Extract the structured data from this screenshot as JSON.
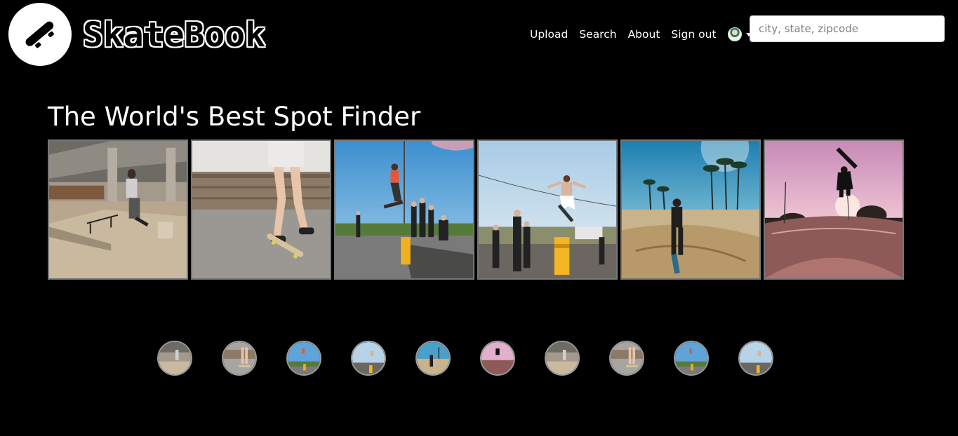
{
  "brand": {
    "name": "SkateBook",
    "logo_icon": "skateboard-icon"
  },
  "nav": {
    "upload_label": "Upload",
    "search_label": "Search",
    "about_label": "About",
    "signout_label": "Sign out",
    "user_avatar_icon": "user-avatar-icon",
    "dropdown_icon": "caret-down-icon"
  },
  "search": {
    "placeholder": "city, state, zipcode",
    "value": ""
  },
  "main": {
    "title": "The World's Best Spot Finder"
  },
  "gallery": {
    "photos": [
      {
        "scene": "indoor-skatepark-rail"
      },
      {
        "scene": "street-skater-legs"
      },
      {
        "scene": "skater-jump-crowd"
      },
      {
        "scene": "skater-jump-barrel"
      },
      {
        "scene": "skatepark-palm-trees"
      },
      {
        "scene": "bowl-air-sunset"
      }
    ]
  },
  "thumbnails": {
    "count_shown": 10
  },
  "colors": {
    "background": "#000000",
    "text": "#ffffff",
    "photo_border": "#777777"
  }
}
